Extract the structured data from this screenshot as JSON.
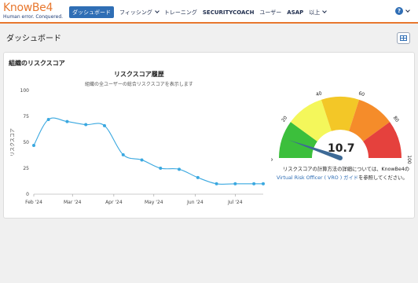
{
  "brand": {
    "logo_text": "KnowBe4",
    "tagline": "Human error. Conquered."
  },
  "nav": {
    "items": [
      {
        "label": "ダッシュボード",
        "active": true,
        "dropdown": false,
        "bold": false
      },
      {
        "label": "フィッシング",
        "active": false,
        "dropdown": true,
        "bold": false
      },
      {
        "label": "トレーニング",
        "active": false,
        "dropdown": false,
        "bold": false
      },
      {
        "label": "SECURITYCOACH",
        "active": false,
        "dropdown": false,
        "bold": true
      },
      {
        "label": "ユーザー",
        "active": false,
        "dropdown": false,
        "bold": false
      },
      {
        "label": "ASAP",
        "active": false,
        "dropdown": false,
        "bold": true
      },
      {
        "label": "以上",
        "active": false,
        "dropdown": true,
        "bold": false
      }
    ],
    "help_label": "?",
    "colors": {
      "accent": "#2f6eb5",
      "brand": "#e8772e"
    }
  },
  "page": {
    "title": "ダッシュボード",
    "layout_button_icon": "layout-grid-icon"
  },
  "card": {
    "title": "組織のリスクスコア"
  },
  "chart_data": {
    "type": "line",
    "title": "リスクスコア履歴",
    "subtitle": "組織の全ユーザーの総合リスクスコアを表示します",
    "ylabel": "リスクスコア",
    "xlabel": "",
    "ylim": [
      0,
      100
    ],
    "yticks": [
      0,
      25,
      50,
      75,
      100
    ],
    "xticks": [
      "Feb '24",
      "Mar '24",
      "Apr '24",
      "May '24",
      "Jun '24",
      "Jul '24"
    ],
    "grid": false,
    "color": "#3aa8e0",
    "series": [
      {
        "x": [
          "2024-02-01",
          "2024-02-12",
          "2024-02-26",
          "2024-03-11",
          "2024-03-25",
          "2024-04-08",
          "2024-04-22",
          "2024-05-06",
          "2024-05-20",
          "2024-06-03",
          "2024-06-17",
          "2024-07-01",
          "2024-07-15",
          "2024-07-22"
        ],
        "values": [
          47,
          72,
          70,
          67,
          66,
          38,
          33,
          25,
          24,
          16,
          10,
          10,
          10,
          10
        ]
      }
    ]
  },
  "gauge": {
    "value": "10.7",
    "value_number": 10.7,
    "min": 0,
    "max": 100,
    "ticks": [
      "0",
      "20",
      "40",
      "60",
      "80",
      "100"
    ],
    "bands": [
      {
        "from": 0,
        "to": 20,
        "color": "#3cbf3c"
      },
      {
        "from": 20,
        "to": 40,
        "color": "#f4f75b"
      },
      {
        "from": 40,
        "to": 60,
        "color": "#f3c727"
      },
      {
        "from": 60,
        "to": 80,
        "color": "#f58c2a"
      },
      {
        "from": 80,
        "to": 100,
        "color": "#e5413d"
      }
    ],
    "needle_color": "#3d6a96",
    "note_line1": "リスクスコアの計算方法の詳細については、KnowBe4の",
    "note_link": "Virtual Risk Officer ( VRO ) ガイド",
    "note_line2_suffix": "を参照してください。"
  }
}
